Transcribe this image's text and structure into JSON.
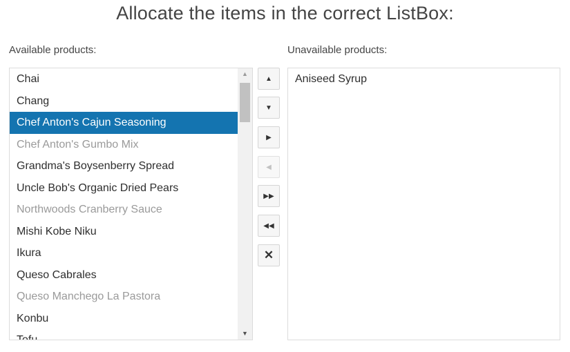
{
  "title": "Allocate the items in the correct ListBox:",
  "available": {
    "label": "Available products:",
    "items": [
      {
        "text": "Chai",
        "state": "normal"
      },
      {
        "text": "Chang",
        "state": "normal"
      },
      {
        "text": "Chef Anton's Cajun Seasoning",
        "state": "selected"
      },
      {
        "text": "Chef Anton's Gumbo Mix",
        "state": "disabled"
      },
      {
        "text": "Grandma's Boysenberry Spread",
        "state": "normal"
      },
      {
        "text": "Uncle Bob's Organic Dried Pears",
        "state": "normal"
      },
      {
        "text": "Northwoods Cranberry Sauce",
        "state": "disabled"
      },
      {
        "text": "Mishi Kobe Niku",
        "state": "normal"
      },
      {
        "text": "Ikura",
        "state": "normal"
      },
      {
        "text": "Queso Cabrales",
        "state": "normal"
      },
      {
        "text": "Queso Manchego La Pastora",
        "state": "disabled"
      },
      {
        "text": "Konbu",
        "state": "normal"
      },
      {
        "text": "Tofu",
        "state": "normal"
      }
    ]
  },
  "unavailable": {
    "label": "Unavailable products:",
    "items": [
      {
        "text": "Aniseed Syrup",
        "state": "normal"
      }
    ]
  },
  "toolbar": [
    {
      "name": "move-up-button",
      "icon": "triangle-up-icon",
      "glyph": "▲",
      "enabled": true
    },
    {
      "name": "move-down-button",
      "icon": "triangle-down-icon",
      "glyph": "▼",
      "enabled": true
    },
    {
      "name": "transfer-to-button",
      "icon": "triangle-right-icon",
      "glyph": "▶",
      "enabled": true
    },
    {
      "name": "transfer-from-button",
      "icon": "triangle-left-icon",
      "glyph": "◀",
      "enabled": false
    },
    {
      "name": "transfer-all-to-button",
      "icon": "double-right-icon",
      "glyph": "▶▶",
      "enabled": true
    },
    {
      "name": "transfer-all-from-button",
      "icon": "double-left-icon",
      "glyph": "◀◀",
      "enabled": true
    },
    {
      "name": "remove-button",
      "icon": "close-icon",
      "glyph": "✕",
      "enabled": true
    }
  ],
  "colors": {
    "selected_bg": "#1474b0",
    "disabled_text": "#9a9a9a"
  }
}
